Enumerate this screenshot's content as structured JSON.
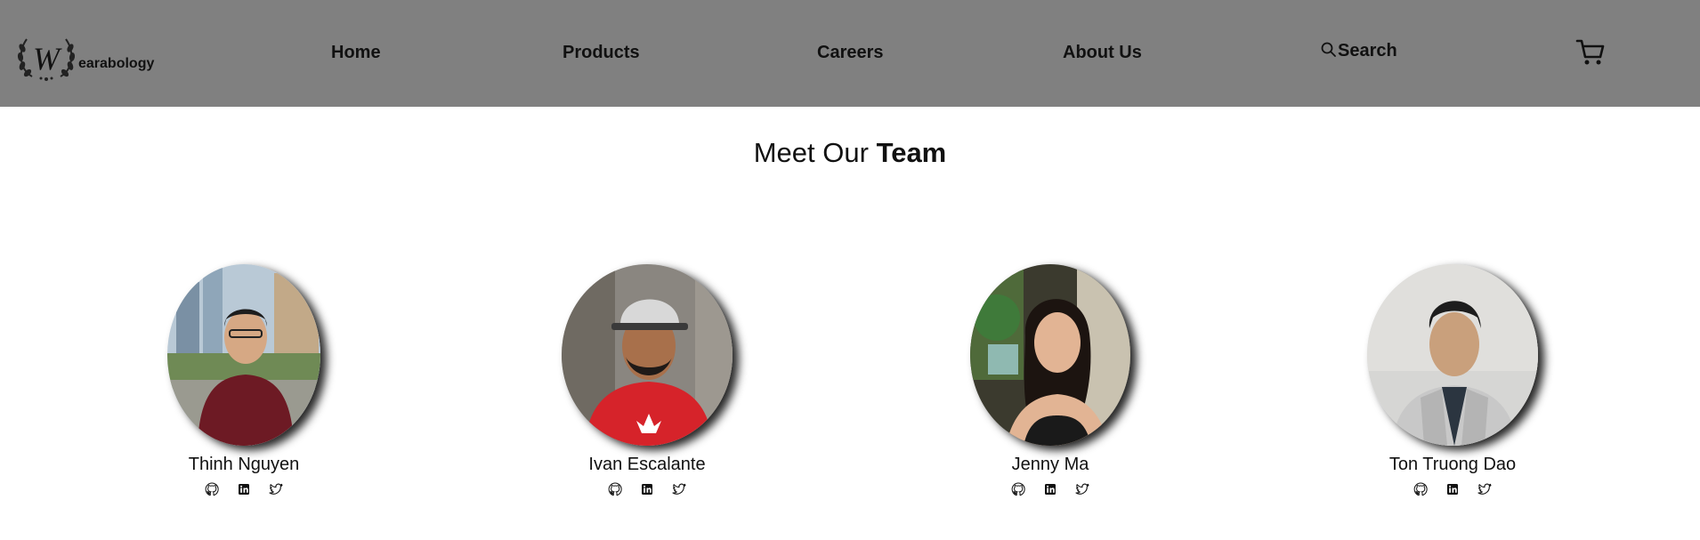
{
  "brand": {
    "logo_letter": "W",
    "logo_text": "earabology"
  },
  "nav": {
    "links": [
      "Home",
      "Products",
      "Careers",
      "About Us"
    ],
    "search_label": "Search"
  },
  "icons": {
    "search": "search-icon",
    "cart": "cart-icon"
  },
  "heading": {
    "prefix": "Meet Our ",
    "emphasis": "Team"
  },
  "team": [
    {
      "name": "Thinh Nguyen",
      "socials": [
        "github-icon",
        "linkedin-icon",
        "twitter-icon"
      ]
    },
    {
      "name": "Ivan Escalante",
      "socials": [
        "github-icon",
        "linkedin-icon",
        "twitter-icon"
      ]
    },
    {
      "name": "Jenny Ma",
      "socials": [
        "github-icon",
        "linkedin-icon",
        "twitter-icon"
      ]
    },
    {
      "name": "Ton Truong Dao",
      "socials": [
        "github-icon",
        "linkedin-icon",
        "twitter-icon"
      ]
    }
  ],
  "colors": {
    "navbar": "#808080",
    "background": "#ffffff",
    "text": "#111111"
  }
}
